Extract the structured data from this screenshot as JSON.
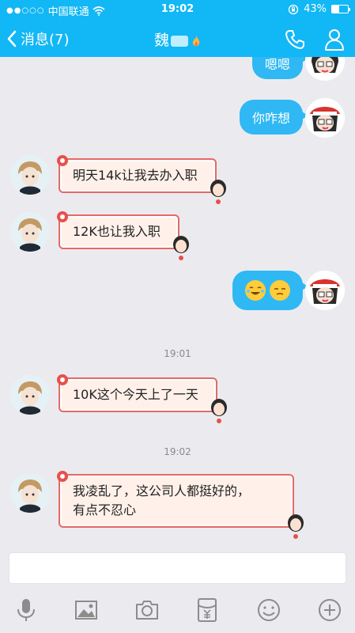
{
  "status": {
    "carrier": "中国联通",
    "signal_dots": "●●○○○",
    "time": "19:02",
    "battery_percent": "43%",
    "battery_level": 0.43
  },
  "nav": {
    "back_label": "消息(7)",
    "contact_name": "魏"
  },
  "messages": [
    {
      "side": "right",
      "text": "嗯嗯",
      "style": "blue"
    },
    {
      "side": "right",
      "text": "你咋想",
      "style": "blue"
    },
    {
      "side": "left",
      "text": "明天14k让我去办入职",
      "style": "red"
    },
    {
      "side": "left",
      "text": "12K也让我入职",
      "style": "red"
    },
    {
      "side": "right",
      "text": "",
      "style": "blue",
      "emojis": [
        "tears-of-joy-emoji",
        "unamused-emoji"
      ]
    },
    {
      "type": "timestamp",
      "text": "19:01"
    },
    {
      "side": "left",
      "text": "10K这个今天上了一天",
      "style": "red"
    },
    {
      "type": "timestamp",
      "text": "19:02"
    },
    {
      "side": "left",
      "lines": [
        "我凌乱了，这公司人都挺好的，",
        "有点不忍心"
      ],
      "style": "red"
    }
  ],
  "input": {
    "placeholder": ""
  },
  "toolbar": {
    "icons": [
      "microphone-icon",
      "image-icon",
      "camera-icon",
      "red-packet-icon",
      "emoji-icon",
      "plus-icon"
    ]
  },
  "colors": {
    "accent": "#12b7f5",
    "bubble_blue": "#2fb8f4",
    "bubble_red_border": "#e56a66",
    "bubble_red_fill": "#fff1ea",
    "background": "#ebebef"
  }
}
